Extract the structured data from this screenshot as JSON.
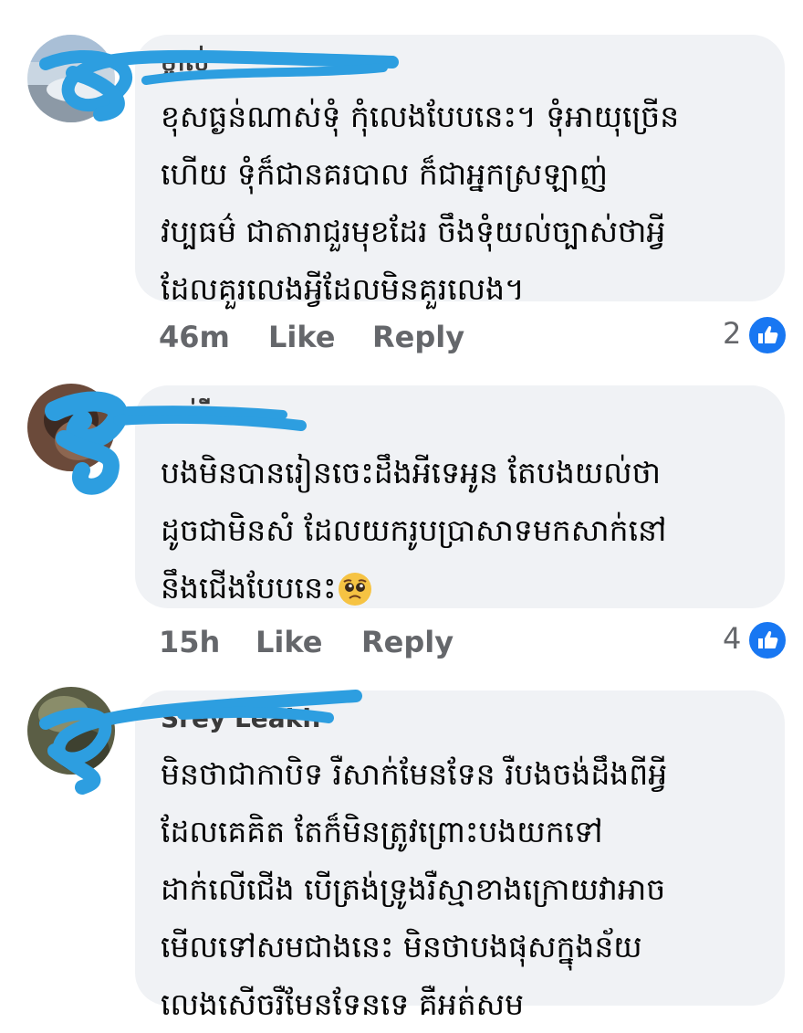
{
  "comments": [
    {
      "author": "ម្ចាស់",
      "lines": [
        "ខុសធ្ងន់ណាស់ទុំ កុំលេងបែបនេះ។ ទុំអាយុច្រើន",
        "ហើយ ទុំក៏ជានគរបាល ក៏ជាអ្នកស្រឡាញ់",
        "វប្បធម៌ ជាតារាជួរមុខដែរ ចឹងទុំយល់ច្បាស់ថាអ្វី",
        "ដែលគួរលេងអ្វីដែលមិនគួរលេង។"
      ],
      "time": "46m",
      "like_label": "Like",
      "reply_label": "Reply",
      "reaction_count": "2",
      "reaction_icon": "thumbs-up-icon"
    },
    {
      "author": "ចាន់រី",
      "lines": [
        "បងមិនបានរៀនចេះដឹងអីទេអូន តែបងយល់ថា",
        "ដូចជាមិនសំ ដែលយករូបប្រាសាទមកសាក់នៅ",
        "នឹងជើងបែបនេះ"
      ],
      "emoji": "pleading-face-emoji",
      "time": "15h",
      "like_label": "Like",
      "reply_label": "Reply",
      "reaction_count": "4",
      "reaction_icon": "thumbs-up-icon"
    },
    {
      "author": "Srey Leakh",
      "lines": [
        "មិនថាជាកាបិទ រឺសាក់មែនទែន រឺបងចង់ដឹងពីអ្វី",
        "ដែលគេគិត តែក៏មិនត្រូវព្រោះបងយកទៅ",
        "ដាក់លើជើង បើត្រង់ទ្រូងរឺស្មាខាងក្រោយវាអាច",
        "មើលទៅសមជាងនេះ មិនថាបងផុសក្នុងន័យ",
        "លេងសើចរឺមែនទែនទេ គឺអត់សម"
      ]
    }
  ],
  "colors": {
    "bubble": "#f0f2f5",
    "meta": "#65676b",
    "like_badge": "#1877f2",
    "scribble": "#2d9ee0"
  }
}
